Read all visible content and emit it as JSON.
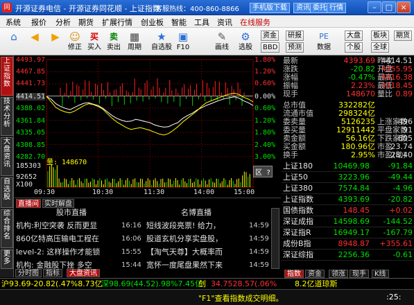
{
  "title": {
    "app": "开源证券电信 - 开源证券同花顺 - 上证指数",
    "hotline": "客服热线：400-860-8866",
    "buttons": [
      "手机版下载",
      "资讯",
      "委托",
      "行情"
    ],
    "win_min": "–",
    "win_max": "□",
    "win_close": "×"
  },
  "menu": [
    "系统",
    "报价",
    "分析",
    "期货",
    "扩展行情",
    "创业板",
    "智能",
    "工具",
    "资讯",
    "在线服务"
  ],
  "toolbar": {
    "tools": [
      {
        "icon": "◀",
        "label": ""
      },
      {
        "icon": "▶",
        "label": ""
      },
      {
        "icon": "☺",
        "label": "修正"
      },
      {
        "icon": "买",
        "label": "买入"
      },
      {
        "icon": "卖",
        "label": "卖出"
      },
      {
        "icon": "▦",
        "label": "周期"
      },
      {
        "icon": "★",
        "label": "自选股"
      },
      {
        "icon": "▣",
        "label": "F10"
      },
      {
        "icon": "✎",
        "label": "画线"
      },
      {
        "icon": "⚙",
        "label": "选股"
      }
    ],
    "right_buttons": [
      "资金",
      "研报",
      "大盘",
      "板块",
      "BBD",
      "预测",
      "数据",
      "个股",
      "全球",
      "期货"
    ]
  },
  "side_tabs": [
    "上证指数",
    "技术分析",
    "大盘资讯",
    "自选股",
    "综合排名",
    "更多"
  ],
  "chart": {
    "y_left": [
      "4493.97",
      "4467.85",
      "4441.73",
      "4414.51",
      "4388.02",
      "4361.84",
      "4335.05",
      "4308.85",
      "4282.70"
    ],
    "y_right": [
      "1.80%",
      "1.20%",
      "0.60%",
      "0.00%",
      "0.60%",
      "1.20%",
      "1.80%",
      "2.40%",
      "3.00%"
    ],
    "vol_label": "量: 148670",
    "vol_y": [
      "185303",
      "92652",
      "X100"
    ],
    "x_labels": [
      "09:30",
      "10:30",
      "11:30",
      "14:00",
      "15:00"
    ],
    "zone_btn": "区 ?"
  },
  "chart_data": {
    "type": "line",
    "series": [
      {
        "values": [
          4414,
          4408,
          4398,
          4392,
          4388,
          4385,
          4390,
          4395,
          4399,
          4400,
          4397,
          4394,
          4388,
          4380,
          4372,
          4366,
          4362,
          4359,
          4360,
          4364,
          4362,
          4359,
          4357,
          4352,
          4349,
          4347,
          4348,
          4353,
          4357,
          4366,
          4372,
          4377,
          4384,
          4389,
          4394,
          4398,
          4402,
          4406,
          4409,
          4411,
          4413,
          4410,
          4404,
          4400,
          4394
        ]
      },
      {
        "values": [
          4414,
          4402,
          4390,
          4384,
          4380,
          4378,
          4382,
          4388,
          4394,
          4398,
          4396,
          4392,
          4386,
          4376,
          4366,
          4358,
          4352,
          4346,
          4342,
          4344,
          4346,
          4343,
          4340,
          4336,
          4332,
          4330,
          4333,
          4340,
          4348,
          4358,
          4366,
          4374,
          4382,
          4392,
          4400,
          4404,
          4408,
          4412,
          4416,
          4419,
          4421,
          4418,
          4412,
          4408,
          4402
        ]
      }
    ],
    "ylim": [
      4282.7,
      4493.97
    ],
    "categories": [
      "09:30",
      "10:30",
      "11:30",
      "14:00",
      "15:00"
    ]
  },
  "quote": {
    "rows": [
      [
        "最新",
        "4393.69",
        "昨收",
        "4414.51"
      ],
      [
        "涨跌",
        "-20.82",
        "开盘",
        "4355.95"
      ],
      [
        "涨幅",
        "-0.47%",
        "最高",
        "4416.38"
      ],
      [
        "振幅",
        "2.23%",
        "最低",
        "4318.45"
      ],
      [
        "现手",
        "148670",
        "量比",
        "0.89"
      ]
    ],
    "rows2": [
      [
        "总市值",
        "332282亿"
      ],
      [
        "流通市值",
        "298324亿"
      ],
      [
        "委卖量",
        "5126235",
        "上涨家数",
        "496"
      ],
      [
        "委买量",
        "12911442",
        "平盘家数",
        "91"
      ],
      [
        "卖金额",
        "56.16亿",
        "下跌家数",
        "605"
      ],
      [
        "买金额",
        "180.96亿",
        "市盈",
        "23.74"
      ],
      [
        "换手",
        "2.95%",
        "市盈(动)",
        "28.40"
      ]
    ]
  },
  "indices": [
    [
      "上证180",
      "10469.98",
      "-91.84"
    ],
    [
      "上证50",
      "3223.96",
      "-49.44"
    ],
    [
      "上证380",
      "7574.84",
      "-4.96"
    ],
    [
      "上证指数",
      "4393.69",
      "-20.82"
    ],
    [
      "国债指数",
      "148.45",
      "+0.02"
    ],
    [
      "深证成指",
      "14598.69",
      "-144.52"
    ],
    [
      "深证指R",
      "16949.17",
      "-167.79"
    ],
    [
      "成份B指",
      "8948.87",
      "+355.61"
    ],
    [
      "深证综指",
      "2256.36",
      "-0.61"
    ]
  ],
  "news": {
    "tabs": [
      "直播间",
      "实时解盘"
    ],
    "hdr_left": "股市直播",
    "hdr_right": "名博直播",
    "left": [
      {
        "text": "机构:利空突袭 反而更显",
        "time": "16:16"
      },
      {
        "text": "860亿特高压输电工程在",
        "time": "16:06"
      },
      {
        "text": "level-2: 这样操作才能锁",
        "time": "15:55"
      },
      {
        "text": "机构: 金融股下挫 多空",
        "time": "15:44"
      }
    ],
    "right": [
      {
        "text": "短线波段亮票! 给力，",
        "time": "14:59"
      },
      {
        "text": "股道玄机分享实盘股，",
        "time": "14:59"
      },
      {
        "text": "【淘气天尊】大概率而",
        "time": "14:59"
      },
      {
        "text": "宽怀一度尾盘果然下来",
        "time": "14:59"
      }
    ]
  },
  "bottom_tabs": [
    "分时图",
    "指标",
    "大盘资讯"
  ],
  "right_tabs": [
    "指数",
    "资金",
    "领涨",
    "现手",
    "K线"
  ],
  "ticker": {
    "sh": "沪93.69-20.82(.47%8.73亿",
    "sz": "深98.69(44.52).98%7.45亿",
    "cy": "创",
    "cy_val": "34.7528.57(.06%",
    "dq": "8.2亿道琼斯"
  },
  "status": {
    "msg": "\"F1\"查看指数成交明细。",
    "time": ":25:",
    "colors": {
      "up": "#ff3030",
      "down": "#00e000",
      "label": "#ffff00"
    }
  }
}
